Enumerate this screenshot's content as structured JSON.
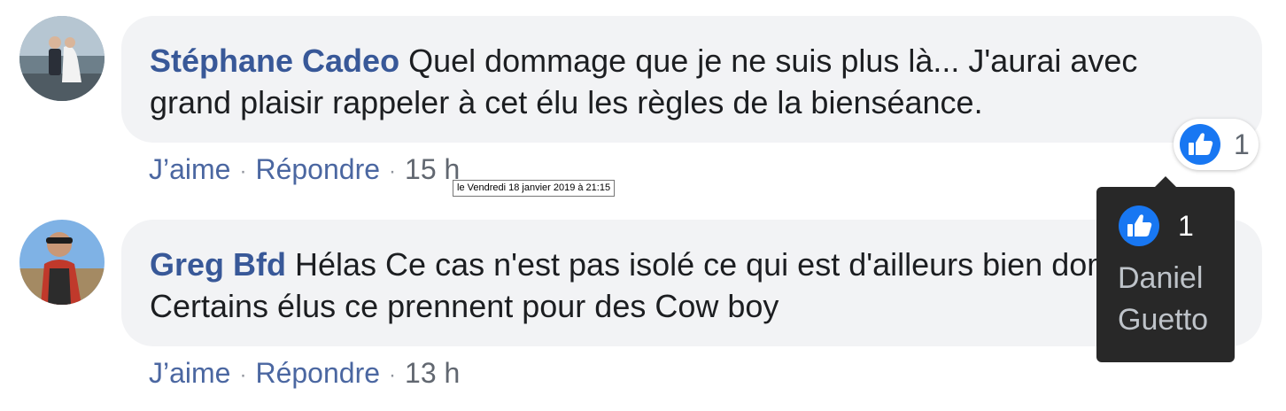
{
  "comments": [
    {
      "author": "Stéphane Cadeo",
      "text": "Quel dommage que je ne suis plus là... J'aurai avec grand plaisir rappeler à cet élu les règles de la bienséance.",
      "like_label": "J’aime",
      "reply_label": "Répondre",
      "time": "15 h",
      "reaction_count": "1"
    },
    {
      "author": "Greg Bfd",
      "text": "Hélas Ce cas n'est pas isolé ce qui est d'ailleurs bien dommage. Certains élus ce prennent pour des Cow boy",
      "like_label": "J’aime",
      "reply_label": "Répondre",
      "time": "13 h"
    }
  ],
  "separator": "·",
  "time_tooltip": "le Vendredi 18 janvier 2019 à 21:15",
  "reaction_tooltip": {
    "count": "1",
    "people": "Daniel Guetto"
  },
  "colors": {
    "author": "#385898",
    "action_link": "#4b67a1",
    "bubble_bg": "#f2f3f5",
    "like_blue": "#1877f2",
    "tooltip_bg": "#282828"
  },
  "icons": [
    "thumbs-up-icon"
  ]
}
